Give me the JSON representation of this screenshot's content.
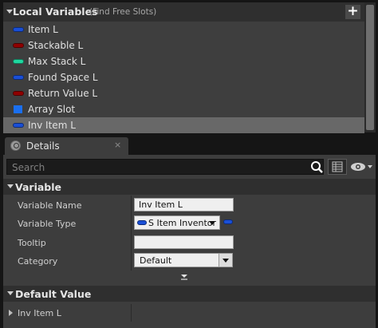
{
  "local_variables": {
    "title": "Local Variables",
    "subtitle": "(Find Free Slots)",
    "add_label": "+",
    "items": [
      {
        "label": "Item L",
        "type_color": "#1a4fd6",
        "icon": "pill"
      },
      {
        "label": "Stackable L",
        "type_color": "#8f0000",
        "icon": "pill"
      },
      {
        "label": "Max Stack L",
        "type_color": "#1fd7a0",
        "icon": "pill"
      },
      {
        "label": "Found Space L",
        "type_color": "#1a4fd6",
        "icon": "pill"
      },
      {
        "label": "Return Value L",
        "type_color": "#8f0000",
        "icon": "pill"
      },
      {
        "label": "Array Slot",
        "type_color": "#1a6ff0",
        "icon": "square"
      },
      {
        "label": "Inv Item L",
        "type_color": "#1a4fd6",
        "icon": "pill",
        "selected": true
      }
    ]
  },
  "details": {
    "tab_label": "Details",
    "tab_close": "×",
    "search": {
      "placeholder": "Search",
      "value": ""
    },
    "variable_section": {
      "title": "Variable",
      "name_label": "Variable Name",
      "name_value": "Inv Item L",
      "type_label": "Variable Type",
      "type_value": "S Item Inventor",
      "tooltip_label": "Tooltip",
      "tooltip_value": "",
      "category_label": "Category",
      "category_value": "Default"
    },
    "default_section": {
      "title": "Default Value",
      "item_label": "Inv Item L"
    }
  }
}
